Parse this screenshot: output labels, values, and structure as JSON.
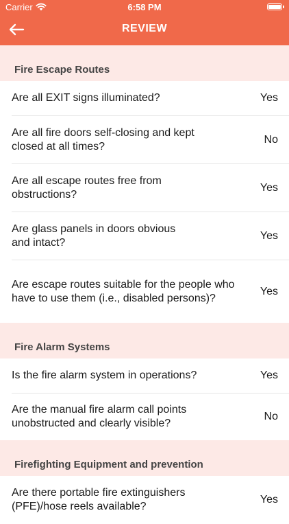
{
  "status_bar": {
    "carrier": "Carrier",
    "time": "6:58 PM"
  },
  "header": {
    "title": "REVIEW"
  },
  "colors": {
    "accent": "#f0694a",
    "section_bg": "#fde9e6"
  },
  "sections": [
    {
      "title": "Fire Escape Routes",
      "items": [
        {
          "question": "Are all EXIT signs illuminated?",
          "answer": "Yes"
        },
        {
          "question": "Are all fire doors self-closing and kept closed at all times?",
          "answer": "No"
        },
        {
          "question": "Are all escape routes free from obstructions?",
          "answer": "Yes"
        },
        {
          "question": "Are glass panels in doors obvious and intact?",
          "answer": "Yes"
        },
        {
          "question": "Are escape routes suitable for the people who have to use them (i.e., disabled persons)?",
          "answer": "Yes"
        }
      ]
    },
    {
      "title": "Fire Alarm Systems",
      "items": [
        {
          "question": "Is the fire alarm system in operations?",
          "answer": "Yes"
        },
        {
          "question": "Are the manual fire alarm call points unobstructed and clearly visible?",
          "answer": "No"
        }
      ]
    },
    {
      "title": "Firefighting Equipment and prevention",
      "items": [
        {
          "question": "Are there portable fire extinguishers (PFE)/hose reels available?",
          "answer": "Yes"
        }
      ]
    }
  ]
}
